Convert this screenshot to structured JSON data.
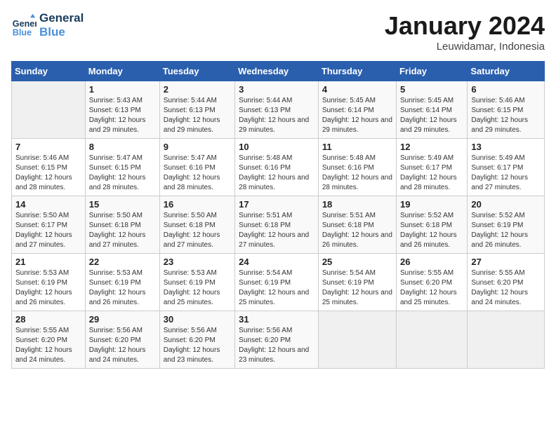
{
  "header": {
    "logo_line1": "General",
    "logo_line2": "Blue",
    "month": "January 2024",
    "location": "Leuwidamar, Indonesia"
  },
  "columns": [
    "Sunday",
    "Monday",
    "Tuesday",
    "Wednesday",
    "Thursday",
    "Friday",
    "Saturday"
  ],
  "weeks": [
    [
      {
        "num": "",
        "empty": true
      },
      {
        "num": "1",
        "sunrise": "5:43 AM",
        "sunset": "6:13 PM",
        "daylight": "12 hours and 29 minutes."
      },
      {
        "num": "2",
        "sunrise": "5:44 AM",
        "sunset": "6:13 PM",
        "daylight": "12 hours and 29 minutes."
      },
      {
        "num": "3",
        "sunrise": "5:44 AM",
        "sunset": "6:13 PM",
        "daylight": "12 hours and 29 minutes."
      },
      {
        "num": "4",
        "sunrise": "5:45 AM",
        "sunset": "6:14 PM",
        "daylight": "12 hours and 29 minutes."
      },
      {
        "num": "5",
        "sunrise": "5:45 AM",
        "sunset": "6:14 PM",
        "daylight": "12 hours and 29 minutes."
      },
      {
        "num": "6",
        "sunrise": "5:46 AM",
        "sunset": "6:15 PM",
        "daylight": "12 hours and 29 minutes."
      }
    ],
    [
      {
        "num": "7",
        "sunrise": "5:46 AM",
        "sunset": "6:15 PM",
        "daylight": "12 hours and 28 minutes."
      },
      {
        "num": "8",
        "sunrise": "5:47 AM",
        "sunset": "6:15 PM",
        "daylight": "12 hours and 28 minutes."
      },
      {
        "num": "9",
        "sunrise": "5:47 AM",
        "sunset": "6:16 PM",
        "daylight": "12 hours and 28 minutes."
      },
      {
        "num": "10",
        "sunrise": "5:48 AM",
        "sunset": "6:16 PM",
        "daylight": "12 hours and 28 minutes."
      },
      {
        "num": "11",
        "sunrise": "5:48 AM",
        "sunset": "6:16 PM",
        "daylight": "12 hours and 28 minutes."
      },
      {
        "num": "12",
        "sunrise": "5:49 AM",
        "sunset": "6:17 PM",
        "daylight": "12 hours and 28 minutes."
      },
      {
        "num": "13",
        "sunrise": "5:49 AM",
        "sunset": "6:17 PM",
        "daylight": "12 hours and 27 minutes."
      }
    ],
    [
      {
        "num": "14",
        "sunrise": "5:50 AM",
        "sunset": "6:17 PM",
        "daylight": "12 hours and 27 minutes."
      },
      {
        "num": "15",
        "sunrise": "5:50 AM",
        "sunset": "6:18 PM",
        "daylight": "12 hours and 27 minutes."
      },
      {
        "num": "16",
        "sunrise": "5:50 AM",
        "sunset": "6:18 PM",
        "daylight": "12 hours and 27 minutes."
      },
      {
        "num": "17",
        "sunrise": "5:51 AM",
        "sunset": "6:18 PM",
        "daylight": "12 hours and 27 minutes."
      },
      {
        "num": "18",
        "sunrise": "5:51 AM",
        "sunset": "6:18 PM",
        "daylight": "12 hours and 26 minutes."
      },
      {
        "num": "19",
        "sunrise": "5:52 AM",
        "sunset": "6:18 PM",
        "daylight": "12 hours and 26 minutes."
      },
      {
        "num": "20",
        "sunrise": "5:52 AM",
        "sunset": "6:19 PM",
        "daylight": "12 hours and 26 minutes."
      }
    ],
    [
      {
        "num": "21",
        "sunrise": "5:53 AM",
        "sunset": "6:19 PM",
        "daylight": "12 hours and 26 minutes."
      },
      {
        "num": "22",
        "sunrise": "5:53 AM",
        "sunset": "6:19 PM",
        "daylight": "12 hours and 26 minutes."
      },
      {
        "num": "23",
        "sunrise": "5:53 AM",
        "sunset": "6:19 PM",
        "daylight": "12 hours and 25 minutes."
      },
      {
        "num": "24",
        "sunrise": "5:54 AM",
        "sunset": "6:19 PM",
        "daylight": "12 hours and 25 minutes."
      },
      {
        "num": "25",
        "sunrise": "5:54 AM",
        "sunset": "6:19 PM",
        "daylight": "12 hours and 25 minutes."
      },
      {
        "num": "26",
        "sunrise": "5:55 AM",
        "sunset": "6:20 PM",
        "daylight": "12 hours and 25 minutes."
      },
      {
        "num": "27",
        "sunrise": "5:55 AM",
        "sunset": "6:20 PM",
        "daylight": "12 hours and 24 minutes."
      }
    ],
    [
      {
        "num": "28",
        "sunrise": "5:55 AM",
        "sunset": "6:20 PM",
        "daylight": "12 hours and 24 minutes."
      },
      {
        "num": "29",
        "sunrise": "5:56 AM",
        "sunset": "6:20 PM",
        "daylight": "12 hours and 24 minutes."
      },
      {
        "num": "30",
        "sunrise": "5:56 AM",
        "sunset": "6:20 PM",
        "daylight": "12 hours and 23 minutes."
      },
      {
        "num": "31",
        "sunrise": "5:56 AM",
        "sunset": "6:20 PM",
        "daylight": "12 hours and 23 minutes."
      },
      {
        "num": "",
        "empty": true
      },
      {
        "num": "",
        "empty": true
      },
      {
        "num": "",
        "empty": true
      }
    ]
  ]
}
